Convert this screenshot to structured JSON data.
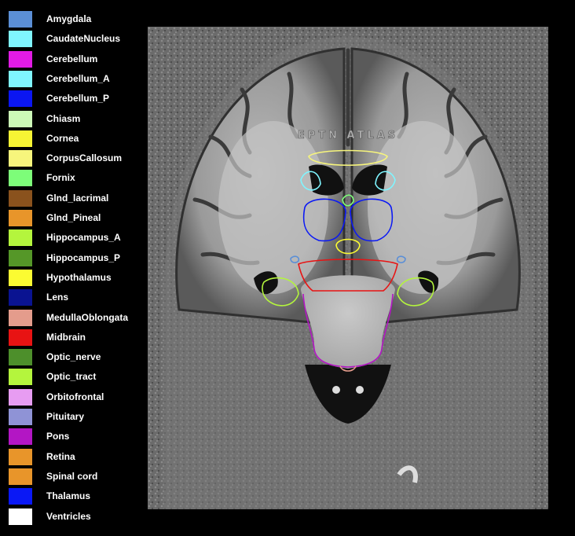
{
  "legend": [
    {
      "label": "Amygdala",
      "color": "#5b8fd6"
    },
    {
      "label": "CaudateNucleus",
      "color": "#7ff5ff"
    },
    {
      "label": "Cerebellum",
      "color": "#e21be5"
    },
    {
      "label": "Cerebellum_A",
      "color": "#7ff5ff"
    },
    {
      "label": "Cerebellum_P",
      "color": "#0b16f2"
    },
    {
      "label": "Chiasm",
      "color": "#ccf9b7"
    },
    {
      "label": "Cornea",
      "color": "#f6f434"
    },
    {
      "label": "CorpusCallosum",
      "color": "#f7f57c"
    },
    {
      "label": "Fornix",
      "color": "#7dfd79"
    },
    {
      "label": "Glnd_lacrimal",
      "color": "#8a521d"
    },
    {
      "label": "Glnd_Pineal",
      "color": "#e8952a"
    },
    {
      "label": "Hippocampus_A",
      "color": "#b4f53d"
    },
    {
      "label": "Hippocampus_P",
      "color": "#559728"
    },
    {
      "label": "Hypothalamus",
      "color": "#fbfb32"
    },
    {
      "label": "Lens",
      "color": "#0a1391"
    },
    {
      "label": "MedullaOblongata",
      "color": "#e49c8c"
    },
    {
      "label": "Midbrain",
      "color": "#e81313"
    },
    {
      "label": "Optic_nerve",
      "color": "#4d8f2b"
    },
    {
      "label": "Optic_tract",
      "color": "#b4f53d"
    },
    {
      "label": "Orbitofrontal",
      "color": "#e79cf2"
    },
    {
      "label": "Pituitary",
      "color": "#8f93d6"
    },
    {
      "label": "Pons",
      "color": "#b316c4"
    },
    {
      "label": "Retina",
      "color": "#e8952a"
    },
    {
      "label": "Spinal cord",
      "color": "#e8952a"
    },
    {
      "label": "Thalamus",
      "color": "#0a18f5"
    },
    {
      "label": "Ventricles",
      "color": "#ffffff"
    }
  ],
  "watermark": "EPTN ATLAS",
  "contour_colors": {
    "corpus_callosum": "#f7f57c",
    "caudate": "#7ff5ff",
    "fornix": "#7dfd79",
    "thalamus": "#0a18f5",
    "hypothalamus": "#fbfb32",
    "midbrain": "#e81313",
    "pons": "#b316c4",
    "medulla": "#e49c8c",
    "hippocampus": "#b4f53d",
    "amygdala": "#5b8fd6",
    "ventricles": "#ffffff"
  }
}
